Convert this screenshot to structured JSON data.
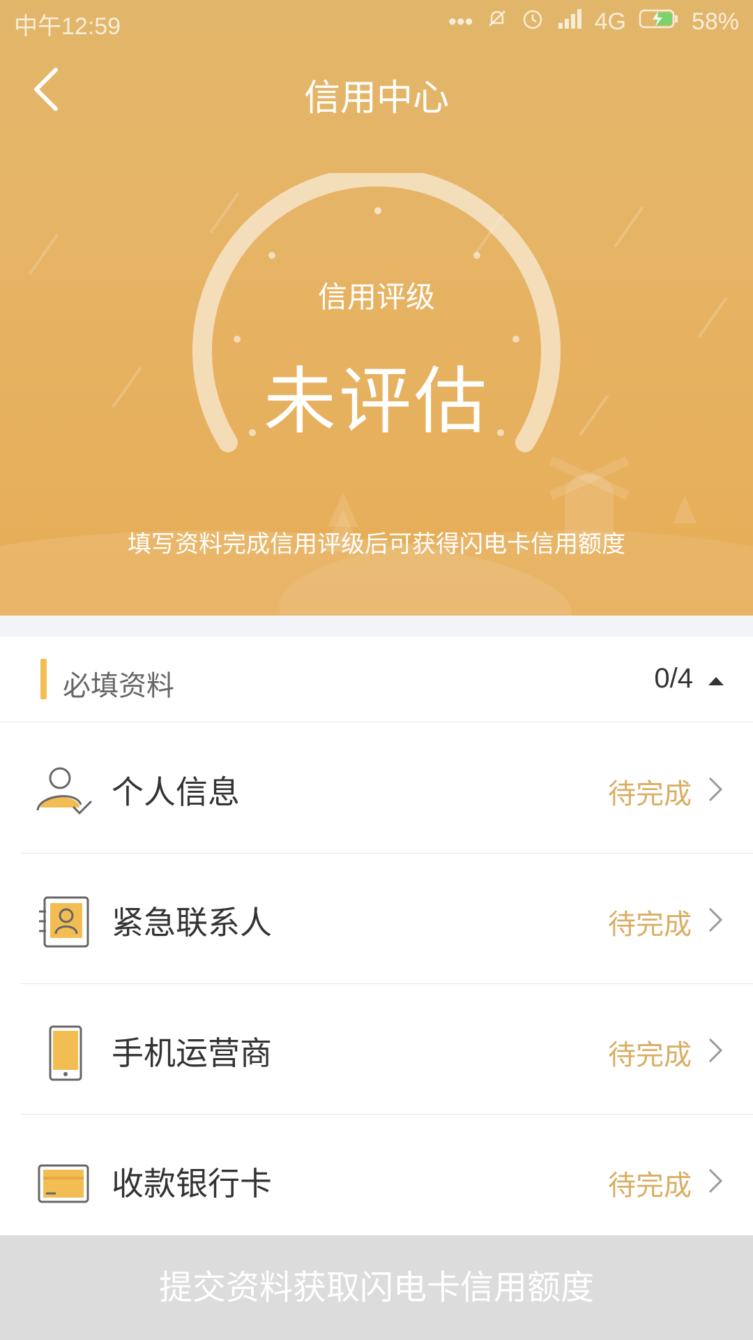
{
  "status_bar": {
    "time": "中午12:59",
    "network": "4G",
    "battery": "58%"
  },
  "nav": {
    "title": "信用中心"
  },
  "credit": {
    "label": "信用评级",
    "value": "未评估",
    "hint": "填写资料完成信用评级后可获得闪电卡信用额度"
  },
  "section": {
    "title": "必填资料",
    "count": "0/4"
  },
  "items": [
    {
      "label": "个人信息",
      "status": "待完成",
      "icon": "personal-info-icon"
    },
    {
      "label": "紧急联系人",
      "status": "待完成",
      "icon": "emergency-contact-icon"
    },
    {
      "label": "手机运营商",
      "status": "待完成",
      "icon": "mobile-carrier-icon"
    },
    {
      "label": "收款银行卡",
      "status": "待完成",
      "icon": "bank-card-icon"
    }
  ],
  "submit": {
    "label": "提交资料获取闪电卡信用额度"
  },
  "colors": {
    "header": "#e4b466",
    "accent": "#f2bd52",
    "status_text": "#d9ae63",
    "button_disabled": "#dcdcdc"
  }
}
